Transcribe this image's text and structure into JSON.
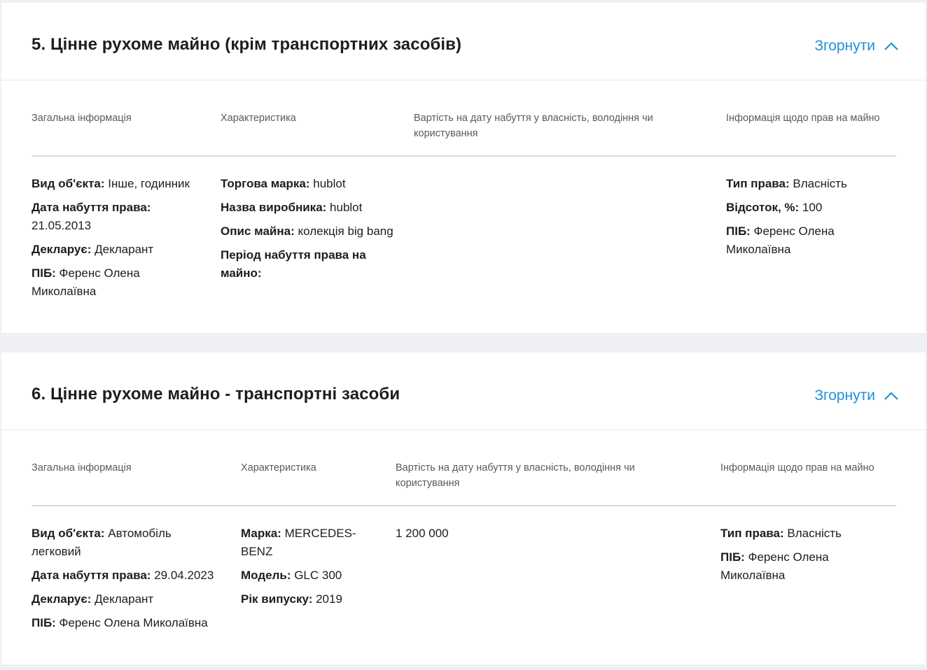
{
  "sections": [
    {
      "title": "5. Цінне рухоме майно (крім транспортних засобів)",
      "collapse_label": "Згорнути",
      "columns": [
        "Загальна інформація",
        "Характеристика",
        "Вартість на дату набуття у власність, володіння чи користування",
        "Інформація щодо прав на майно"
      ],
      "general": [
        {
          "label": "Вид об'єкта:",
          "value": " Інше, годинник"
        },
        {
          "label": "Дата набуття права:",
          "value": " 21.05.2013"
        },
        {
          "label": "Декларує:",
          "value": " Декларант"
        },
        {
          "label": "ПІБ:",
          "value": " Ференс Олена Миколаївна"
        }
      ],
      "characteristics": [
        {
          "label": "Торгова марка:",
          "value": " hublot"
        },
        {
          "label": "Назва виробника:",
          "value": " hublot"
        },
        {
          "label": "Опис майна:",
          "value": " колекція big bang"
        },
        {
          "label": "Період набуття права на майно:",
          "value": ""
        }
      ],
      "cost": "",
      "rights": [
        {
          "label": "Тип права:",
          "value": " Власність"
        },
        {
          "label": "Відсоток, %:",
          "value": " 100"
        },
        {
          "label": "ПІБ:",
          "value": " Ференс Олена Миколаївна"
        }
      ]
    },
    {
      "title": "6. Цінне рухоме майно - транспортні засоби",
      "collapse_label": "Згорнути",
      "columns": [
        "Загальна інформація",
        "Характеристика",
        "Вартість на дату набуття у власність, володіння чи користування",
        "Інформація щодо прав на майно"
      ],
      "general": [
        {
          "label": "Вид об'єкта:",
          "value": " Автомобіль легковий"
        },
        {
          "label": "Дата набуття права:",
          "value": " 29.04.2023"
        },
        {
          "label": "Декларує:",
          "value": " Декларант"
        },
        {
          "label": "ПІБ:",
          "value": " Ференс Олена Миколаївна"
        }
      ],
      "characteristics": [
        {
          "label": "Марка:",
          "value": " MERCEDES-BENZ"
        },
        {
          "label": "Модель:",
          "value": " GLC 300"
        },
        {
          "label": "Рік випуску:",
          "value": " 2019"
        }
      ],
      "cost": "1 200 000",
      "rights": [
        {
          "label": "Тип права:",
          "value": " Власність"
        },
        {
          "label": "ПІБ:",
          "value": " Ференс Олена Миколаївна"
        }
      ]
    }
  ],
  "colors": {
    "accent": "#1f8fd8",
    "background": "#eff0f4",
    "card": "#ffffff"
  }
}
